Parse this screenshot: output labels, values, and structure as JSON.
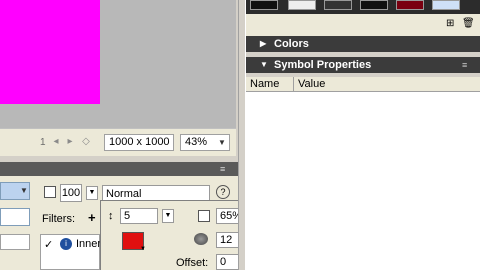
{
  "stage": {
    "frame_numbers": [
      "1"
    ],
    "size_label": "1000 x 1000",
    "zoom": "43%"
  },
  "properties": {
    "alpha_value": "100",
    "blend_mode": "Normal",
    "filters_label": "Filters:",
    "add_filter": "+",
    "filter_item": "Inner",
    "filter_item_check": "✓"
  },
  "filter_popup": {
    "distance": "5",
    "strength": "65%",
    "knockout": "12",
    "offset_label": "Offset:",
    "offset_value": "0",
    "shadow_color": "#e01010"
  },
  "right_panel": {
    "colors_title": "Colors",
    "symbol_properties_title": "Symbol Properties",
    "columns": [
      "Name",
      "Value"
    ]
  }
}
